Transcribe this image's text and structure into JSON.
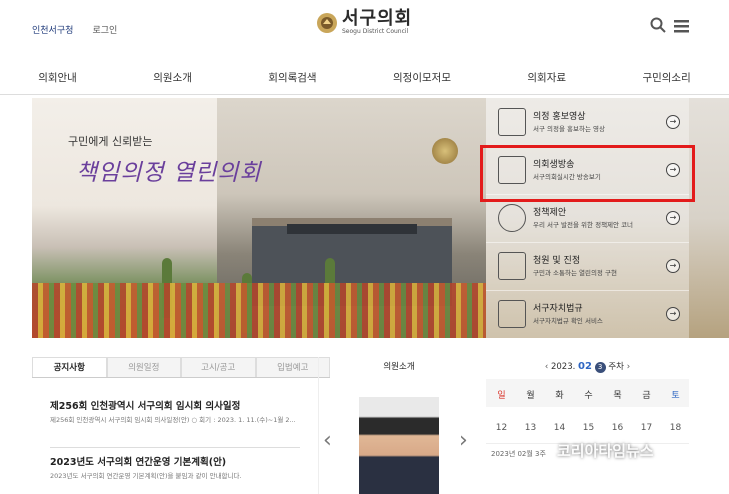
{
  "header": {
    "util_links": [
      "인천서구청",
      "로그인"
    ],
    "logo_main": "서구의회",
    "logo_sub": "Seogu District Council"
  },
  "nav": [
    "의회안내",
    "의원소개",
    "회의록검색",
    "의정이모저모",
    "의회자료",
    "구민의소리"
  ],
  "hero": {
    "subtitle": "구민에게 신뢰받는",
    "title": "책임의정 열린의회"
  },
  "side_menu": [
    {
      "title": "의정 홍보영상",
      "desc": "서구 의정을 홍보하는 영상",
      "icon": "video-icon"
    },
    {
      "title": "의회생방송",
      "desc": "서구의회실시간 방송보기",
      "icon": "live-broadcast-icon"
    },
    {
      "title": "정책제안",
      "desc": "우리 서구 발전을 위한 정책제안 코너",
      "icon": "globe-icon"
    },
    {
      "title": "청원 및 진정",
      "desc": "구민과 소통하는 열린의정 구현",
      "icon": "building-icon"
    },
    {
      "title": "서구자치법규",
      "desc": "서구자치법규 확인 서비스",
      "icon": "law-book-icon"
    }
  ],
  "tabs": [
    "공지사항",
    "의원일정",
    "고시/공고",
    "입법예고"
  ],
  "news": [
    {
      "title": "제256회 인천광역시 서구의회 임시회 의사일정",
      "desc": "제256회 인천광역시 서구의회 임시회 의사일정(안) ○ 회기 : 2023. 1. 11.(수)~1월 2..."
    },
    {
      "title": "2023년도 서구의회 연간운영 기본계획(안)",
      "desc": "2023년도 서구의회 연간운영 기본계획(안)을 붙임과 같이 안내합니다."
    }
  ],
  "member": {
    "header": "의원소개"
  },
  "calendar": {
    "year_label": "2023.",
    "month": "02",
    "week": "3",
    "week_suffix": "주차",
    "weekdays": [
      "일",
      "월",
      "화",
      "수",
      "목",
      "금",
      "토"
    ],
    "dates": [
      "12",
      "13",
      "14",
      "15",
      "16",
      "17",
      "18"
    ],
    "footer": "2023년 02월 3주"
  },
  "watermark": "코리아타임뉴스",
  "colors": {
    "accent_purple": "#6a3f9c",
    "highlight_red": "#e31b1b",
    "sunday_red": "#d9352c",
    "saturday_blue": "#2e66c3",
    "week_badge": "#3a4f7a"
  }
}
